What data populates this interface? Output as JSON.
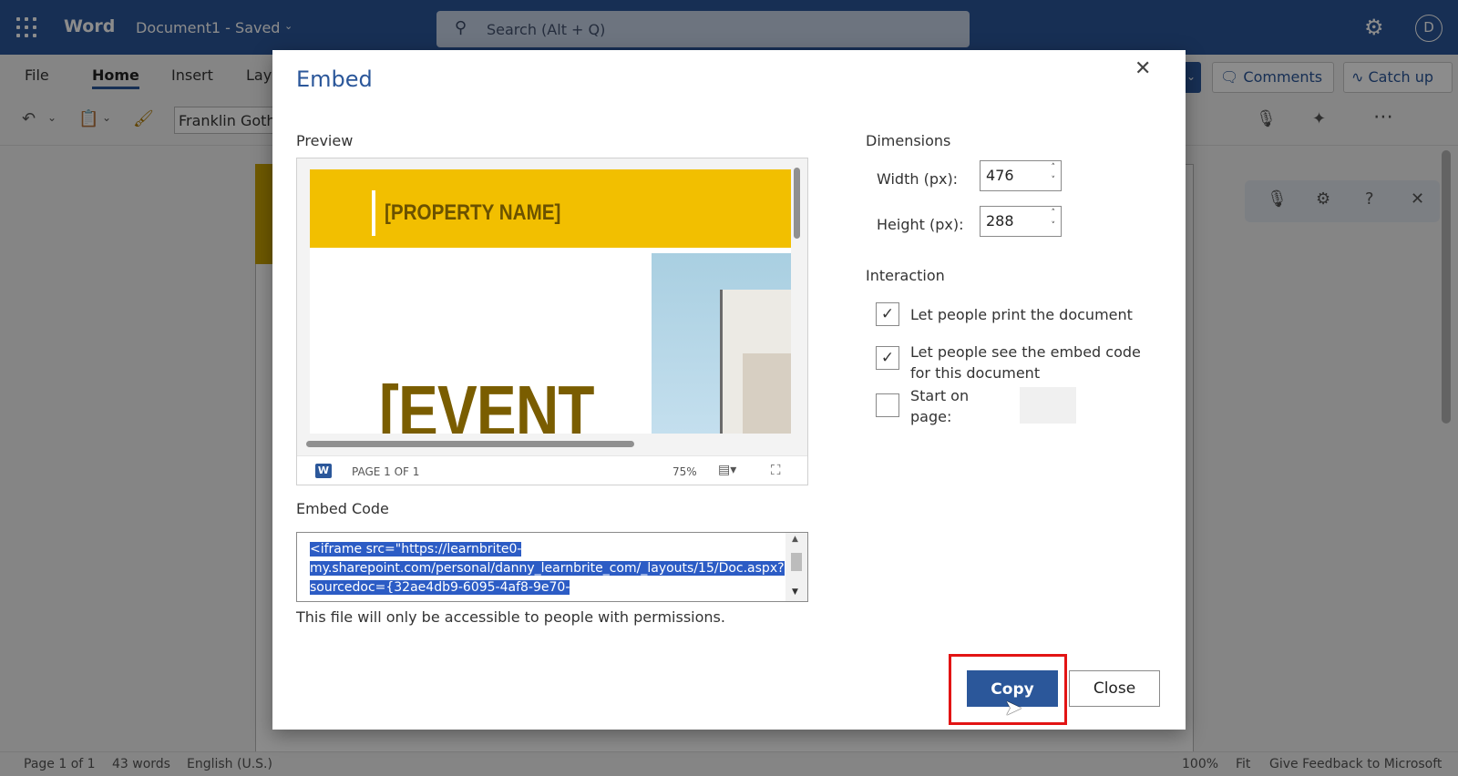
{
  "app": {
    "name": "Word",
    "doc_title": "Document1",
    "doc_status": "Saved",
    "search_placeholder": "Search (Alt + Q)",
    "avatar_initial": "D"
  },
  "ribbon": {
    "tabs": [
      "File",
      "Home",
      "Insert",
      "Layo"
    ],
    "font_name": "Franklin Goth",
    "comments_label": "Comments",
    "catchup_label": "Catch up"
  },
  "statusbar": {
    "page": "Page 1 of 1",
    "words": "43 words",
    "language": "English (U.S.)",
    "zoom": "100%",
    "fit": "Fit",
    "feedback": "Give Feedback to Microsoft"
  },
  "dialog": {
    "title": "Embed",
    "preview_label": "Preview",
    "preview": {
      "property_name": "[PROPERTY NAME]",
      "event_text": "[EVENT",
      "page_indicator": "PAGE 1 OF 1",
      "zoom": "75%"
    },
    "embed_code_label": "Embed Code",
    "embed_code_lines": [
      "<iframe src=\"https://learnbrite0-",
      "my.sharepoint.com/personal/danny_learnbrite_com/_layouts/15/Doc.aspx?",
      "sourcedoc={32ae4db9-6095-4af8-9e70-"
    ],
    "permissions_note": "This file will only be accessible to people with permissions.",
    "dimensions_label": "Dimensions",
    "width_label": "Width (px):",
    "width_value": "476",
    "height_label": "Height (px):",
    "height_value": "288",
    "interaction_label": "Interaction",
    "options": [
      {
        "label": "Let people print the document",
        "checked": true
      },
      {
        "label": "Let people see the embed code for this document",
        "checked": true
      },
      {
        "label": "Start on page:",
        "checked": false
      }
    ],
    "copy_label": "Copy",
    "close_label": "Close"
  },
  "icons": [
    "waffle-icon",
    "search-icon",
    "gear-icon",
    "close-icon",
    "chevron-down-icon",
    "checkmark-icon",
    "word-icon",
    "fullscreen-icon",
    "mouse-pointer-icon",
    "microphone-icon",
    "help-icon",
    "comment-icon",
    "undo-icon",
    "clipboard-icon",
    "format-painter-icon"
  ],
  "colors": {
    "brand": "#2b579a",
    "highlight": "#e21414",
    "preview_banner": "#f2bf00"
  }
}
